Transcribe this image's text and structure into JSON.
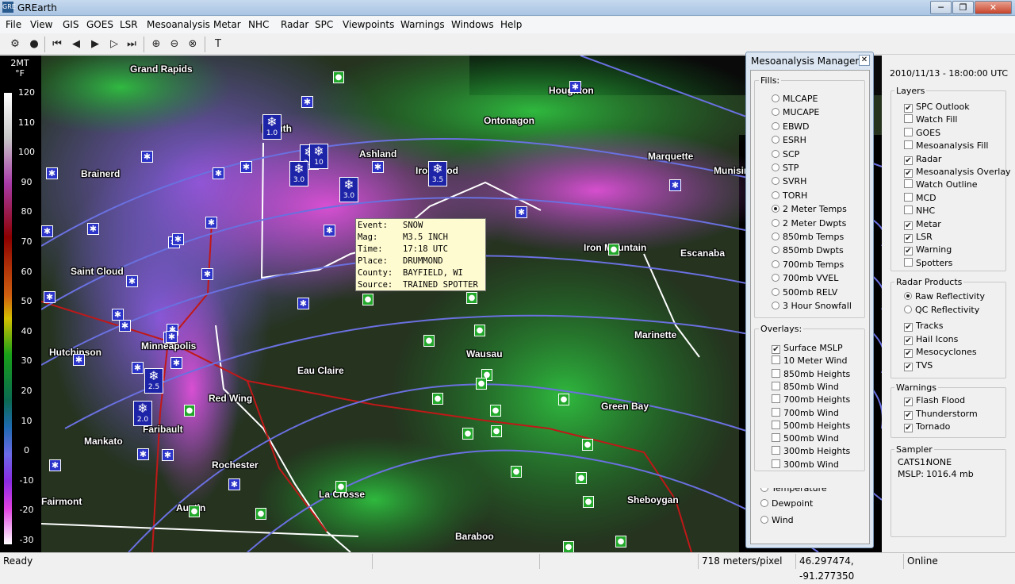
{
  "window": {
    "title": "GREarth",
    "minimize": "─",
    "restore": "❐",
    "close": "✕"
  },
  "menu": [
    "File",
    "View",
    "GIS",
    "GOES",
    "LSR",
    "Mesoanalysis",
    "Metar",
    "NHC",
    "Radar",
    "SPC",
    "Viewpoints",
    "Warnings",
    "Windows",
    "Help"
  ],
  "toolbar": {
    "icons": [
      "gear-icon",
      "record-icon",
      "skip-first-icon",
      "step-back-icon",
      "play-icon",
      "step-forward-icon",
      "skip-last-icon",
      "zoom-in-icon",
      "zoom-out-icon",
      "zoom-reset-icon",
      "text-tool-icon"
    ]
  },
  "legend": {
    "title1": "2MT",
    "title2": "°F",
    "ticks": [
      "120",
      "110",
      "100",
      "90",
      "80",
      "70",
      "60",
      "50",
      "40",
      "30",
      "20",
      "10",
      "0",
      "-10",
      "-20",
      "-30"
    ]
  },
  "cities": [
    "Grand Rapids",
    "Brainerd",
    "Saint Cloud",
    "Hutchinson",
    "Minneapolis",
    "Mankato",
    "Fairmont",
    "Faribault",
    "Red Wing",
    "Rochester",
    "Austin",
    "Eau Claire",
    "La Crosse",
    "Baraboo",
    "Wausau",
    "Green Bay",
    "Sheboygan",
    "Marinette",
    "Escanaba",
    "Iron Mountain",
    "Marquette",
    "Munising",
    "Houghton",
    "Ontonagon",
    "Ashland",
    "Ironwood",
    "Duluth"
  ],
  "snow_reports": [
    "1.0",
    "2.5",
    "3.0",
    "3.0",
    "3.5",
    "2.5",
    "2.0",
    "10"
  ],
  "popup": {
    "rows": [
      [
        "Event:",
        "SNOW"
      ],
      [
        "Mag:",
        "M3.5 INCH"
      ],
      [
        "Time:",
        "17:18 UTC"
      ],
      [
        "Place:",
        "DRUMMOND"
      ],
      [
        "County:",
        "BAYFIELD, WI"
      ],
      [
        "Source:",
        "TRAINED SPOTTER"
      ]
    ]
  },
  "meso": {
    "title": "Mesoanalysis Manager",
    "close": "✕",
    "fills_label": "Fills:",
    "fills": [
      "MLCAPE",
      "MUCAPE",
      "EBWD",
      "ESRH",
      "SCP",
      "STP",
      "SVRH",
      "TORH",
      "2 Meter Temps",
      "2 Meter Dwpts",
      "850mb Temps",
      "850mb Dwpts",
      "700mb Temps",
      "700mb VVEL",
      "500mb RELV",
      "3 Hour Snowfall"
    ],
    "fill_selected": "2 Meter Temps",
    "overlays_label": "Overlays:",
    "overlays": [
      {
        "label": "Surface MSLP",
        "checked": true
      },
      {
        "label": "10 Meter Wind",
        "checked": false
      },
      {
        "label": "850mb Heights",
        "checked": false
      },
      {
        "label": "850mb Wind",
        "checked": false
      },
      {
        "label": "700mb Heights",
        "checked": false
      },
      {
        "label": "700mb Wind",
        "checked": false
      },
      {
        "label": "500mb Heights",
        "checked": false
      },
      {
        "label": "500mb Wind",
        "checked": false
      },
      {
        "label": "300mb Heights",
        "checked": false
      },
      {
        "label": "300mb Wind",
        "checked": false
      }
    ],
    "behind": [
      "Temperature",
      "Dewpoint",
      "Wind"
    ]
  },
  "right": {
    "datetime": "2010/11/13 - 18:00:00 UTC",
    "layers_label": "Layers",
    "layers": [
      {
        "label": "SPC Outlook",
        "checked": true
      },
      {
        "label": "Watch Fill",
        "checked": false
      },
      {
        "label": "GOES",
        "checked": false
      },
      {
        "label": "Mesoanalysis Fill",
        "checked": false
      },
      {
        "label": "Radar",
        "checked": true
      },
      {
        "label": "Mesoanalysis Overlay",
        "checked": true
      },
      {
        "label": "Watch Outline",
        "checked": false
      },
      {
        "label": "MCD",
        "checked": false
      },
      {
        "label": "NHC",
        "checked": false
      },
      {
        "label": "Metar",
        "checked": true
      },
      {
        "label": "LSR",
        "checked": true
      },
      {
        "label": "Warning",
        "checked": true
      },
      {
        "label": "Spotters",
        "checked": false
      }
    ],
    "radar_label": "Radar Products",
    "radar_opts": [
      "Raw Reflectivity",
      "QC Reflectivity"
    ],
    "radar_selected": "Raw Reflectivity",
    "radar_checks": [
      {
        "label": "Tracks",
        "checked": true
      },
      {
        "label": "Hail Icons",
        "checked": true
      },
      {
        "label": "Mesocyclones",
        "checked": true
      },
      {
        "label": "TVS",
        "checked": true
      }
    ],
    "warnings_label": "Warnings",
    "warnings": [
      {
        "label": "Flash Flood",
        "checked": true
      },
      {
        "label": "Thunderstorm",
        "checked": true
      },
      {
        "label": "Tornado",
        "checked": true
      }
    ],
    "sampler_label": "Sampler",
    "sampler": [
      [
        "CATS1:",
        "NONE"
      ],
      [
        "MSLP:",
        "1016.4 mb"
      ]
    ]
  },
  "status": {
    "ready": "Ready",
    "scale": "718 meters/pixel",
    "coords": "46.297474, -91.277350",
    "online": "Online"
  }
}
